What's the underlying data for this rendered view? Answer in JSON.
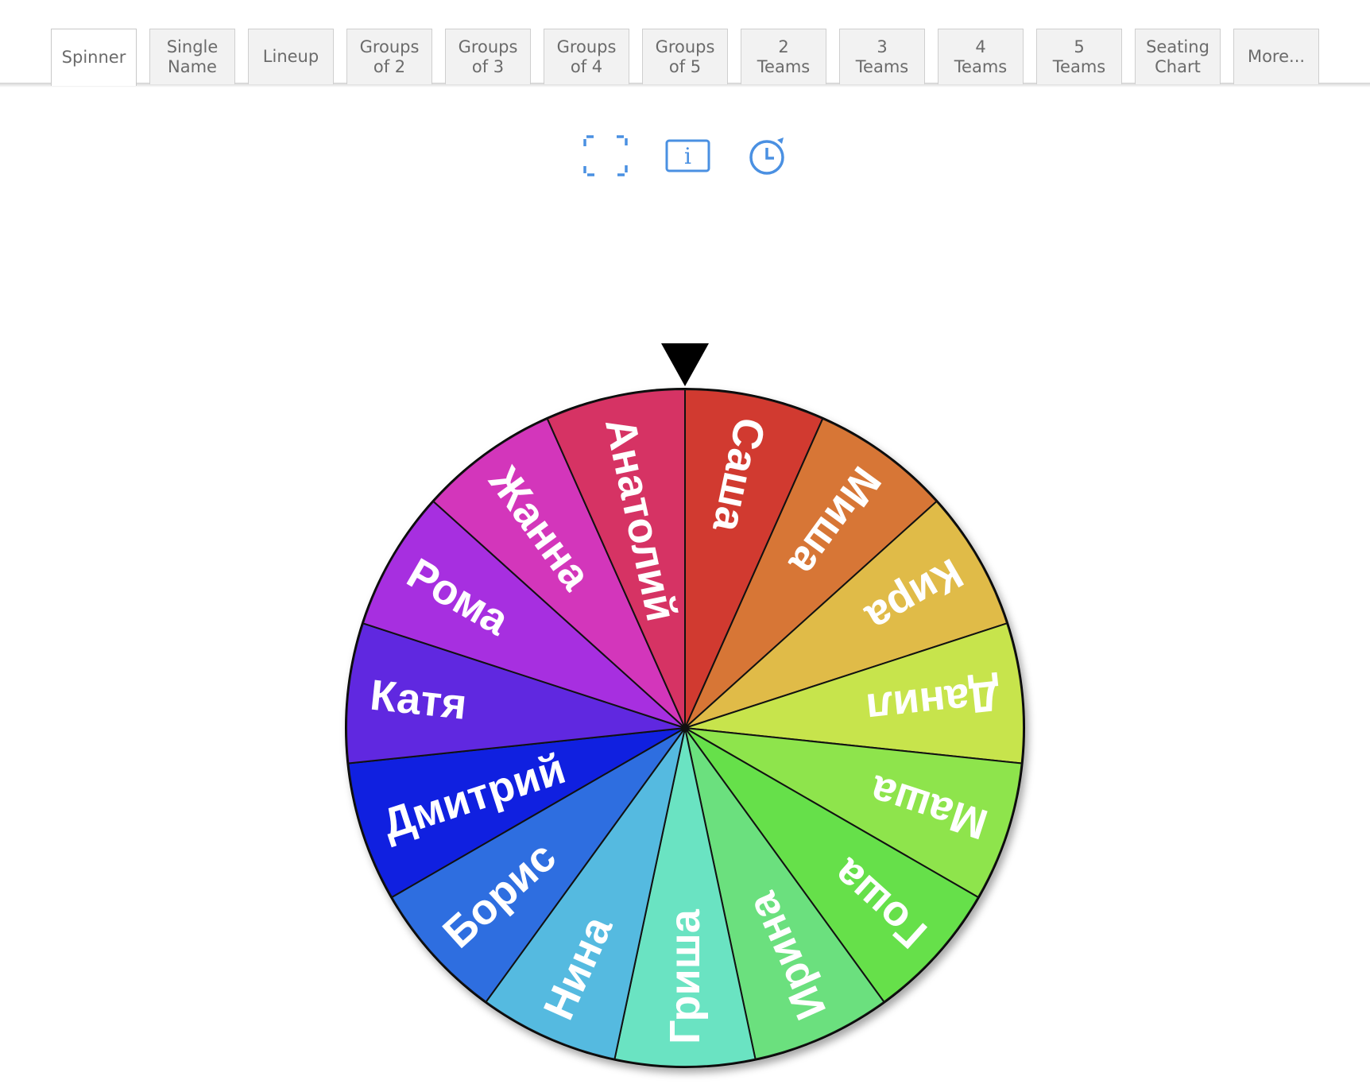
{
  "tabs": [
    {
      "line1": "Spinner",
      "line2": "",
      "active": true
    },
    {
      "line1": "Single",
      "line2": "Name"
    },
    {
      "line1": "Lineup",
      "line2": ""
    },
    {
      "line1": "Groups",
      "line2": "of 2"
    },
    {
      "line1": "Groups",
      "line2": "of 3"
    },
    {
      "line1": "Groups",
      "line2": "of 4"
    },
    {
      "line1": "Groups",
      "line2": "of 5"
    },
    {
      "line1": "2",
      "line2": "Teams"
    },
    {
      "line1": "3",
      "line2": "Teams"
    },
    {
      "line1": "4",
      "line2": "Teams"
    },
    {
      "line1": "5",
      "line2": "Teams"
    },
    {
      "line1": "Seating",
      "line2": "Chart"
    },
    {
      "line1": "More...",
      "line2": ""
    }
  ],
  "toolbar": {
    "icons": [
      "fullscreen-icon",
      "info-icon",
      "timer-icon"
    ],
    "accent_color": "#4a90e2"
  },
  "wheel": {
    "pointer_color": "#000000",
    "segments": [
      {
        "name": "Саша",
        "color": "#d13a30"
      },
      {
        "name": "Миша",
        "color": "#d77636"
      },
      {
        "name": "Кира",
        "color": "#e0bb48"
      },
      {
        "name": "Данил",
        "color": "#c7e44c"
      },
      {
        "name": "Маша",
        "color": "#8ee44c"
      },
      {
        "name": "Гоша",
        "color": "#66e04a"
      },
      {
        "name": "Ирина",
        "color": "#6be07e"
      },
      {
        "name": "Гриша",
        "color": "#6ae3c2"
      },
      {
        "name": "Нина",
        "color": "#55bae0"
      },
      {
        "name": "Борис",
        "color": "#2e6ee0"
      },
      {
        "name": "Дмитрий",
        "color": "#1020e0"
      },
      {
        "name": "Катя",
        "color": "#6028e0"
      },
      {
        "name": "Рома",
        "color": "#a72fe0"
      },
      {
        "name": "Жанна",
        "color": "#d336bb"
      },
      {
        "name": "Анатолий",
        "color": "#d63364"
      }
    ]
  }
}
